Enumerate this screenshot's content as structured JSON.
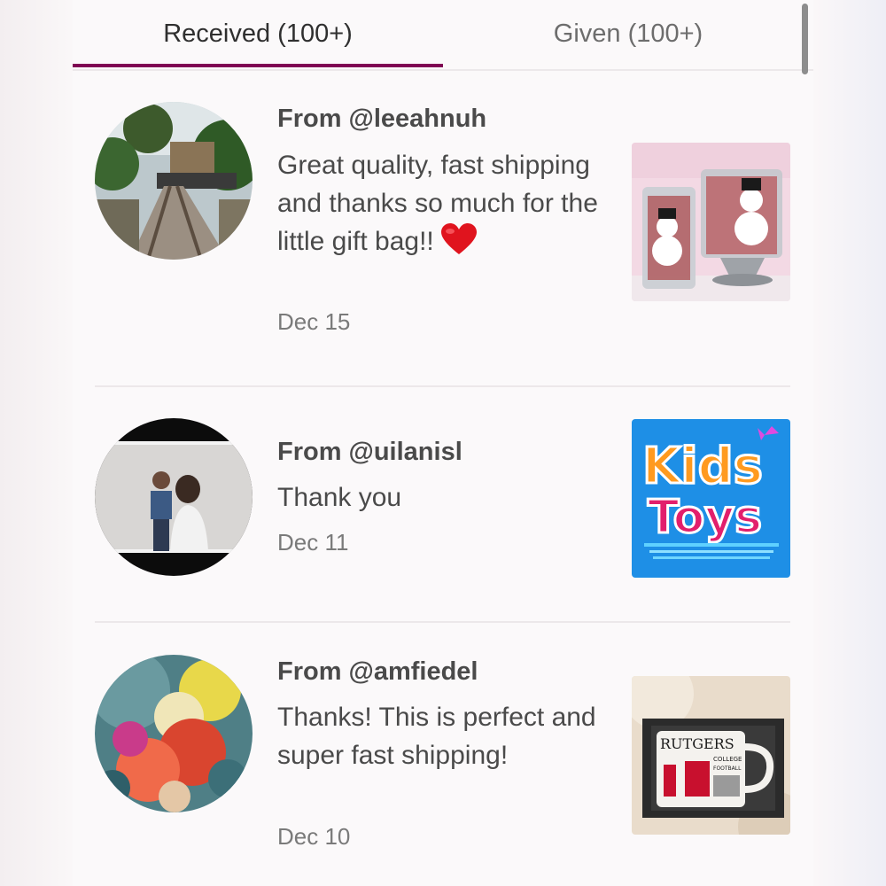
{
  "tabs": {
    "received_label": "Received (100+)",
    "given_label": "Given (100+)",
    "active": "received"
  },
  "colors": {
    "accent": "#7f0353",
    "text_primary": "#4a4a4a",
    "text_secondary": "#7a7a7a"
  },
  "reviews": [
    {
      "from": "From @leeahnuh",
      "message": "Great quality, fast shipping and thanks so much for the little gift bag!!",
      "emoji": "red-heart",
      "date": "Dec 15",
      "avatar": "railroad-tracks-photo",
      "thumbnail": "snowman-candle-holders-photo"
    },
    {
      "from": "From @uilanisl",
      "message": "Thank you",
      "date": "Dec 11",
      "avatar": "family-photo",
      "thumbnail": "kids-toys-logo",
      "thumbnail_text": [
        "Kids",
        "Toys"
      ]
    },
    {
      "from": "From @amfiedel",
      "message": "Thanks! This is perfect and super fast shipping!",
      "date": "Dec 10",
      "avatar": "abstract-paint-photo",
      "thumbnail": "rutgers-mug-photo",
      "thumbnail_text": [
        "RUTGERS",
        "COLLEGE",
        "FOOTBALL"
      ]
    }
  ]
}
